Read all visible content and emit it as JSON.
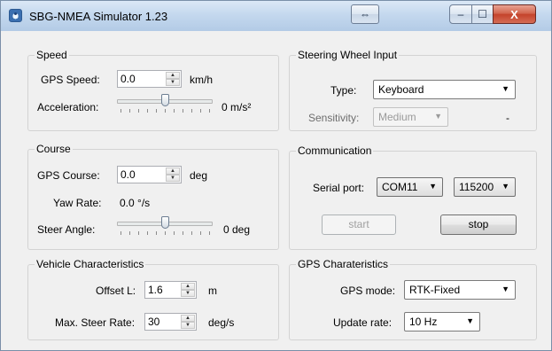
{
  "window": {
    "title": "SBG-NMEA Simulator 1.23",
    "swap_glyph": "⇔",
    "min_glyph": "–",
    "max_glyph": "☐",
    "close_glyph": "X"
  },
  "speed": {
    "legend": "Speed",
    "gps_speed_label": "GPS Speed:",
    "gps_speed_value": "0.0",
    "gps_speed_unit": "km/h",
    "acceleration_label": "Acceleration:",
    "acceleration_value": "0 m/s²",
    "acceleration_level": 0.5
  },
  "course": {
    "legend": "Course",
    "gps_course_label": "GPS Course:",
    "gps_course_value": "0.0",
    "gps_course_unit": "deg",
    "yaw_rate_label": "Yaw Rate:",
    "yaw_rate_value": "0.0 °/s",
    "steer_angle_label": "Steer Angle:",
    "steer_angle_value": "0 deg",
    "steer_angle_level": 0.5
  },
  "vehicle": {
    "legend": "Vehicle Characteristics",
    "offset_label": "Offset L:",
    "offset_value": "1.6",
    "offset_unit": "m",
    "max_steer_rate_label": "Max. Steer Rate:",
    "max_steer_rate_value": "30",
    "max_steer_rate_unit": "deg/s"
  },
  "steering": {
    "legend": "Steering Wheel Input",
    "type_label": "Type:",
    "type_value": "Keyboard",
    "sensitivity_label": "Sensitivity:",
    "sensitivity_value": "Medium",
    "sensitivity_readout": "-"
  },
  "communication": {
    "legend": "Communication",
    "serial_port_label": "Serial port:",
    "serial_port_value": "COM11",
    "baud_value": "115200",
    "start_label": "start",
    "stop_label": "stop"
  },
  "gps": {
    "legend": "GPS Charateristics",
    "mode_label": "GPS mode:",
    "mode_value": "RTK-Fixed",
    "update_rate_label": "Update rate:",
    "update_rate_value": "10 Hz"
  },
  "icons": {
    "spin_up": "▲",
    "spin_down": "▼",
    "combo_arrow": "▼"
  }
}
